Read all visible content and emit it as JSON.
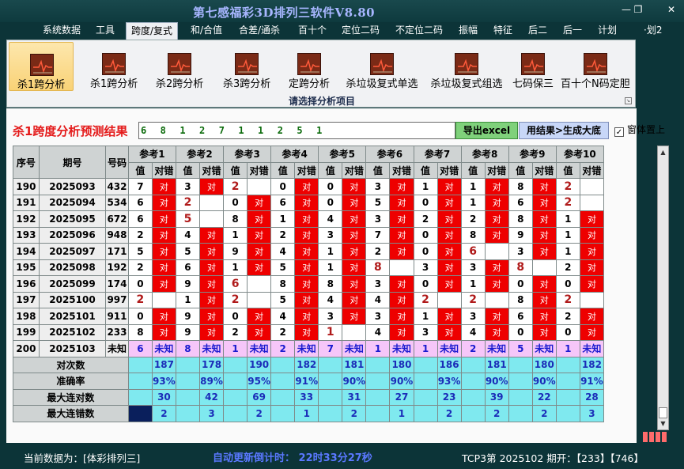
{
  "app": {
    "title": "第七感福彩3D排列三软件V8.80",
    "minimize": "—",
    "maximize": "❐",
    "close": "✕"
  },
  "menu": {
    "items": [
      "系统数据",
      "工具",
      "跨度/复式",
      "和/合值",
      "合差/通杀",
      "百十个",
      "定位二码",
      "不定位二码",
      "振幅",
      "特征",
      "后二",
      "后一",
      "计划",
      "·划2"
    ],
    "active_index": 2
  },
  "ribbon": {
    "buttons": [
      "杀1跨分析",
      "杀1跨分析",
      "杀2跨分析",
      "杀3跨分析",
      "定跨分析",
      "杀垃圾复式单选",
      "杀垃圾复式组选",
      "七码保三",
      "百十个N码定胆"
    ],
    "selected_index": 0,
    "icon": "chart-line-icon",
    "caption": "请选择分析项目",
    "corner": "↘"
  },
  "result": {
    "title": "杀1跨度分析预测结果",
    "values": "6  8  1  2  7  1  1  2  5  1",
    "export_label": "导出excel",
    "generate_label": "用结果>生成大底",
    "topmost_label": "窗体置上",
    "topmost_checked": "✓"
  },
  "table": {
    "col_headers": {
      "seq": "序号",
      "period": "期号",
      "number": "号码",
      "value": "值",
      "hit": "对错"
    },
    "refs": [
      "参考1",
      "参考2",
      "参考3",
      "参考4",
      "参考5",
      "参考6",
      "参考7",
      "参考8",
      "参考9",
      "参考10"
    ],
    "rows": [
      {
        "seq": "190",
        "period": "2025093",
        "number": "432",
        "cells": [
          [
            "7",
            1
          ],
          [
            "3",
            1
          ],
          [
            "2",
            0
          ],
          [
            "0",
            1
          ],
          [
            "0",
            1
          ],
          [
            "3",
            1
          ],
          [
            "1",
            1
          ],
          [
            "1",
            1
          ],
          [
            "8",
            1
          ],
          [
            "2",
            0
          ]
        ]
      },
      {
        "seq": "191",
        "period": "2025094",
        "number": "534",
        "cells": [
          [
            "6",
            1
          ],
          [
            "2",
            0
          ],
          [
            "0",
            1
          ],
          [
            "6",
            1
          ],
          [
            "0",
            1
          ],
          [
            "5",
            1
          ],
          [
            "0",
            1
          ],
          [
            "1",
            1
          ],
          [
            "6",
            1
          ],
          [
            "2",
            0
          ]
        ]
      },
      {
        "seq": "192",
        "period": "2025095",
        "number": "672",
        "cells": [
          [
            "6",
            1
          ],
          [
            "5",
            0
          ],
          [
            "8",
            1
          ],
          [
            "1",
            1
          ],
          [
            "4",
            1
          ],
          [
            "3",
            1
          ],
          [
            "2",
            1
          ],
          [
            "2",
            1
          ],
          [
            "8",
            1
          ],
          [
            "1",
            1
          ]
        ]
      },
      {
        "seq": "193",
        "period": "2025096",
        "number": "948",
        "cells": [
          [
            "2",
            1
          ],
          [
            "4",
            1
          ],
          [
            "1",
            1
          ],
          [
            "2",
            1
          ],
          [
            "3",
            1
          ],
          [
            "7",
            1
          ],
          [
            "0",
            1
          ],
          [
            "8",
            1
          ],
          [
            "9",
            1
          ],
          [
            "1",
            1
          ]
        ]
      },
      {
        "seq": "194",
        "period": "2025097",
        "number": "171",
        "cells": [
          [
            "5",
            1
          ],
          [
            "5",
            1
          ],
          [
            "9",
            1
          ],
          [
            "4",
            1
          ],
          [
            "1",
            1
          ],
          [
            "2",
            1
          ],
          [
            "0",
            1
          ],
          [
            "6",
            0
          ],
          [
            "3",
            1
          ],
          [
            "1",
            1
          ]
        ]
      },
      {
        "seq": "195",
        "period": "2025098",
        "number": "192",
        "cells": [
          [
            "2",
            1
          ],
          [
            "6",
            1
          ],
          [
            "1",
            1
          ],
          [
            "5",
            1
          ],
          [
            "1",
            1
          ],
          [
            "8",
            0
          ],
          [
            "3",
            1
          ],
          [
            "3",
            1
          ],
          [
            "8",
            0
          ],
          [
            "2",
            1
          ]
        ]
      },
      {
        "seq": "196",
        "period": "2025099",
        "number": "174",
        "cells": [
          [
            "0",
            1
          ],
          [
            "9",
            1
          ],
          [
            "6",
            0
          ],
          [
            "8",
            1
          ],
          [
            "8",
            1
          ],
          [
            "3",
            1
          ],
          [
            "0",
            1
          ],
          [
            "1",
            1
          ],
          [
            "0",
            1
          ],
          [
            "0",
            1
          ]
        ]
      },
      {
        "seq": "197",
        "period": "2025100",
        "number": "997",
        "cells": [
          [
            "2",
            0
          ],
          [
            "1",
            1
          ],
          [
            "2",
            0
          ],
          [
            "5",
            1
          ],
          [
            "4",
            1
          ],
          [
            "4",
            1
          ],
          [
            "2",
            0
          ],
          [
            "2",
            0
          ],
          [
            "8",
            1
          ],
          [
            "2",
            0
          ]
        ]
      },
      {
        "seq": "198",
        "period": "2025101",
        "number": "911",
        "cells": [
          [
            "0",
            1
          ],
          [
            "9",
            1
          ],
          [
            "0",
            1
          ],
          [
            "4",
            1
          ],
          [
            "3",
            1
          ],
          [
            "3",
            1
          ],
          [
            "1",
            1
          ],
          [
            "3",
            1
          ],
          [
            "6",
            1
          ],
          [
            "2",
            1
          ]
        ]
      },
      {
        "seq": "199",
        "period": "2025102",
        "number": "233",
        "cells": [
          [
            "8",
            1
          ],
          [
            "9",
            1
          ],
          [
            "2",
            1
          ],
          [
            "2",
            1
          ],
          [
            "1",
            0
          ],
          [
            "4",
            1
          ],
          [
            "3",
            1
          ],
          [
            "4",
            1
          ],
          [
            "0",
            1
          ],
          [
            "0",
            1
          ]
        ]
      }
    ],
    "hit_label": "对",
    "unknown_row": {
      "seq": "200",
      "period": "2025103",
      "number": "未知",
      "values": [
        "6",
        "8",
        "1",
        "2",
        "7",
        "1",
        "1",
        "2",
        "5",
        "1"
      ],
      "label": "未知"
    },
    "stats": [
      {
        "label": "对次数",
        "values": [
          "187",
          "178",
          "190",
          "182",
          "181",
          "180",
          "186",
          "181",
          "180",
          "182"
        ]
      },
      {
        "label": "准确率",
        "values": [
          "93%",
          "89%",
          "95%",
          "91%",
          "90%",
          "90%",
          "93%",
          "90%",
          "90%",
          "91%"
        ]
      },
      {
        "label": "最大连对数",
        "values": [
          "30",
          "42",
          "69",
          "33",
          "31",
          "27",
          "23",
          "39",
          "22",
          "28"
        ]
      },
      {
        "label": "最大连错数",
        "values": [
          "2",
          "3",
          "2",
          "1",
          "2",
          "1",
          "2",
          "2",
          "2",
          "3"
        ]
      }
    ]
  },
  "scrollbar": {
    "up": "▲",
    "down": "▼"
  },
  "status": {
    "current": "当前数据为：[体彩排列三]",
    "countdown": "自动更新倒计时：  22时33分27秒",
    "period": "TCP3第 2025102 期开：【233】【746】"
  }
}
